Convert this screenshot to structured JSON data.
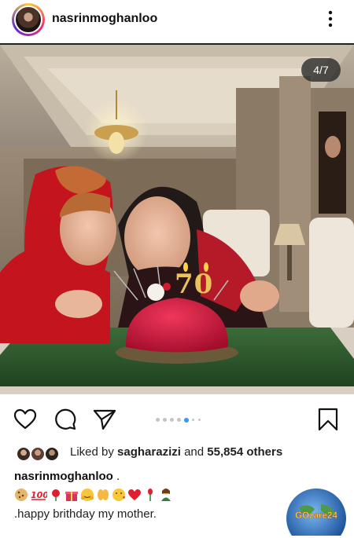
{
  "post": {
    "username": "nasrinmoghanloo",
    "slide_counter": "4/7",
    "carousel": {
      "total_dots": 7,
      "active_index": 4
    }
  },
  "photo": {
    "cake_candles": "70"
  },
  "likes": {
    "prefix": "Liked by ",
    "user": "sagharazizi",
    "middle": " and ",
    "count": "55,854 others"
  },
  "caption": {
    "username": "nasrinmoghanloo",
    "suffix": " .",
    "emojis": [
      "cookie",
      "hundred-points",
      "rose",
      "gift",
      "hug-face",
      "raising-hands",
      "kiss-face",
      "heart",
      "rosebud",
      "woman-person"
    ],
    "text": ".happy brithday my mother."
  },
  "watermark": {
    "text": "GOzare24"
  },
  "icons": {
    "more": "more-vertical-icon",
    "like": "heart-outline-icon",
    "comment": "comment-icon",
    "share": "paper-plane-icon",
    "save": "bookmark-icon"
  },
  "colors": {
    "accent_blue": "#3897f0",
    "badge_bg": "#282828",
    "cake_red": "#c8123a",
    "scarf_red": "#c4141e",
    "tablecloth_green": "#2f5a2e"
  }
}
